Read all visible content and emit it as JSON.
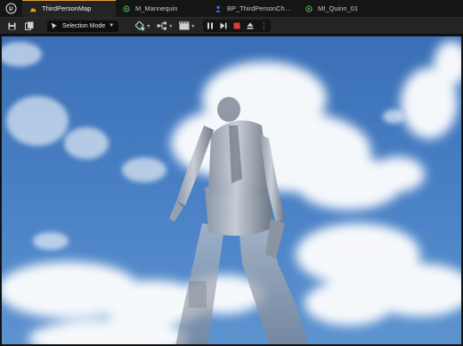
{
  "editor": {
    "tabs": [
      {
        "label": "ThirdPersonMap",
        "icon": "level-icon",
        "active": true
      },
      {
        "label": "M_Mannequin",
        "icon": "material-icon",
        "active": false
      },
      {
        "label": "BP_ThirdPersonChara...",
        "icon": "blueprint-icon",
        "active": false
      },
      {
        "label": "MI_Quinn_01",
        "icon": "material-instance-icon",
        "active": false
      }
    ],
    "toolbar": {
      "selection_mode_label": "Selection Mode",
      "left_icons": [
        "save-icon",
        "content-browser-icon"
      ],
      "mid_icons": [
        "add-actor-icon",
        "blueprint-menu-icon",
        "cinematics-icon"
      ],
      "play_controls": [
        "pause-icon",
        "skip-frame-icon",
        "stop-icon",
        "eject-icon",
        "more-options-icon"
      ]
    },
    "colors": {
      "accent": "#e0a030",
      "stop": "#e03a3a",
      "sky": "#3f74b8",
      "toolbar": "#242424"
    }
  }
}
